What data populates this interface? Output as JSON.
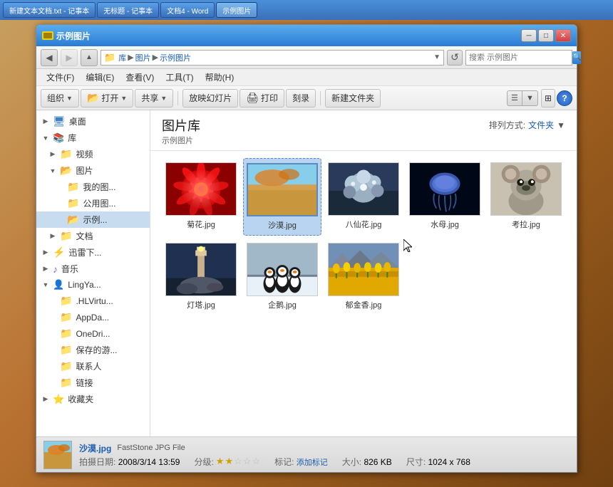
{
  "taskbar": {
    "buttons": [
      {
        "label": "新建文本文档.txt - 记事本",
        "active": false
      },
      {
        "label": "无标题 - 记事本",
        "active": false
      },
      {
        "label": "文档4 - Word",
        "active": false
      },
      {
        "label": "示例图片",
        "active": true
      }
    ]
  },
  "window": {
    "title": "示例图片",
    "address": {
      "path": [
        "库",
        "图片",
        "示例图片"
      ],
      "search_placeholder": "搜索 示例图片"
    }
  },
  "menu": {
    "items": [
      "文件(F)",
      "编辑(E)",
      "查看(V)",
      "工具(T)",
      "帮助(H)"
    ]
  },
  "toolbar": {
    "buttons": [
      {
        "label": "组织",
        "dropdown": true
      },
      {
        "label": "打开",
        "dropdown": true
      },
      {
        "label": "共享",
        "dropdown": true
      },
      {
        "label": "放映幻灯片"
      },
      {
        "label": "打印"
      },
      {
        "label": "刻录"
      },
      {
        "label": "新建文件夹"
      }
    ]
  },
  "sidebar": {
    "items": [
      {
        "label": "桌面",
        "indent": 0,
        "icon": "desktop",
        "expanded": false
      },
      {
        "label": "库",
        "indent": 0,
        "icon": "library",
        "expanded": true
      },
      {
        "label": "视频",
        "indent": 1,
        "icon": "folder"
      },
      {
        "label": "图片",
        "indent": 1,
        "icon": "folder",
        "expanded": true
      },
      {
        "label": "我的图...",
        "indent": 2,
        "icon": "folder"
      },
      {
        "label": "公用图...",
        "indent": 2,
        "icon": "folder"
      },
      {
        "label": "示例...",
        "indent": 2,
        "icon": "folder",
        "selected": true
      },
      {
        "label": "文档",
        "indent": 1,
        "icon": "folder"
      },
      {
        "label": "迅雷下...",
        "indent": 0,
        "icon": "thunder"
      },
      {
        "label": "音乐",
        "indent": 0,
        "icon": "music"
      },
      {
        "label": "LingYa...",
        "indent": 0,
        "icon": "person"
      },
      {
        "label": ".HLVirtu...",
        "indent": 1,
        "icon": "folder"
      },
      {
        "label": "AppDa...",
        "indent": 1,
        "icon": "folder"
      },
      {
        "label": "OneDri...",
        "indent": 1,
        "icon": "folder"
      },
      {
        "label": "保存的游...",
        "indent": 1,
        "icon": "folder"
      },
      {
        "label": "联系人",
        "indent": 1,
        "icon": "folder"
      },
      {
        "label": "链接",
        "indent": 1,
        "icon": "folder"
      },
      {
        "label": "收藏夹",
        "indent": 0,
        "icon": "star"
      }
    ]
  },
  "panel": {
    "library_title": "图片库",
    "subtitle": "示例图片",
    "sort_label": "排列方式:",
    "sort_value": "文件夹",
    "sort_arrow": "▼"
  },
  "files": [
    {
      "name": "菊花.jpg",
      "thumb": "juhua",
      "selected": false
    },
    {
      "name": "沙漠.jpg",
      "thumb": "shamo",
      "selected": true
    },
    {
      "name": "八仙花.jpg",
      "thumb": "baxianhua",
      "selected": false
    },
    {
      "name": "水母.jpg",
      "thumb": "shuimu",
      "selected": false
    },
    {
      "name": "考拉.jpg",
      "thumb": "koala",
      "selected": false
    },
    {
      "name": "灯塔.jpg",
      "thumb": "dengta",
      "selected": false
    },
    {
      "name": "企鹅.jpg",
      "thumb": "qie",
      "selected": false
    },
    {
      "name": "郁金香.jpg",
      "thumb": "yujinxiang",
      "selected": false
    }
  ],
  "status": {
    "filename": "沙漠.jpg",
    "filetype": "FastStone JPG File",
    "date_label": "拍摄日期:",
    "date_value": "2008/3/14 13:59",
    "rating_label": "分级:",
    "stars_filled": 2,
    "stars_empty": 3,
    "tag_label": "标记:",
    "tag_value": "添加标记",
    "size_label": "大小:",
    "size_value": "826 KB",
    "dim_label": "尺寸:",
    "dim_value": "1024 x 768"
  },
  "nav": {
    "back_label": "◀",
    "forward_label": "▶",
    "up_label": "↑",
    "refresh_label": "↺"
  },
  "icons": {
    "search": "🔍",
    "folder_yellow": "📁",
    "folder_open": "📂",
    "desktop": "🖥",
    "music": "♪",
    "person": "👤",
    "star": "⭐",
    "thunder": "⚡",
    "library": "📚"
  }
}
